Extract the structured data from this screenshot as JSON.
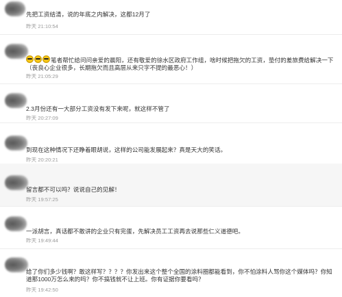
{
  "comments": [
    {
      "text": "先把工资结清，说的年底之内解决，这都12月了",
      "time": "昨天 21:10:54"
    },
    {
      "emoji_prefix": "😎😎😎",
      "text": "笔者帮忙给问问亲爱的晨阳，还有敬爱的徐水区政府工作组，啥时候把拖欠的工资，垫付的差旅费给解决一下（丧良心企业很多，长期拖欠而且高层从来只字不提的最恶心！）",
      "time": "昨天 21:05:29"
    },
    {
      "text": "2.3月份还有一大部分工资没有发下来呢，就这样不管了",
      "time": "昨天 20:27:09"
    },
    {
      "text": "到现在这种情况下还睁着眼胡说，这样的公司能发展起来？真是天大的笑话。",
      "time": "昨天 20:20:21"
    },
    {
      "text": "留言都不可以吗？说说自己的见解！",
      "time": "昨天 19:57:25"
    },
    {
      "text": "一派胡言，真话都不敢讲的企业只有完蛋，先解决员工工资再去说那些仁义道德吧。",
      "time": "昨天 19:49:44"
    },
    {
      "text": "给了你们多少钱啊？敢这样写？？？？你发出来这个整个全国的涂料圈都能看到，你不怕涂料人骂你这个媒体吗？你知道那1000万怎么来的吗？你不搞钱就不让上班。你有证据你要看吗？",
      "time": "昨天 19:42:50"
    }
  ]
}
